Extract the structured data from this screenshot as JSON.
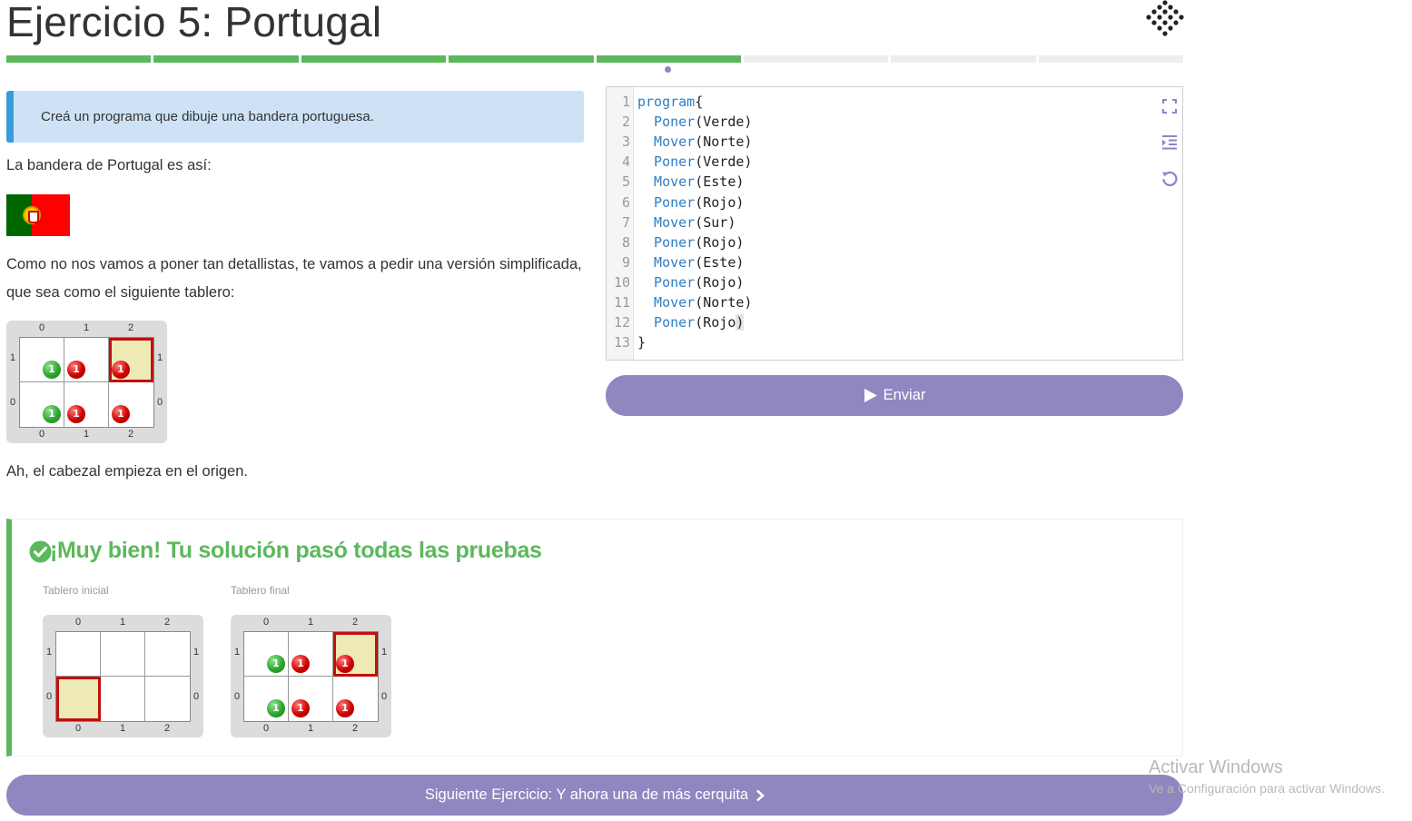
{
  "page": {
    "title": "Ejercicio 5: Portugal"
  },
  "progress": {
    "segments": 8,
    "completed": 5,
    "current": 5
  },
  "statement": {
    "task": "Creá un programa que dibuje una bandera portuguesa.",
    "intro": "La bandera de Portugal es así:",
    "line1": "Como no nos vamos a poner tan detallistas, te vamos a pedir una versión simplificada,",
    "line2": "que sea como el siguiente tablero:",
    "footer": "Ah, el cabezal empieza en el origen."
  },
  "board_labels": {
    "cols": [
      "0",
      "1",
      "2"
    ],
    "rows": [
      "1",
      "0"
    ]
  },
  "boards": {
    "example": {
      "head": {
        "col": 2,
        "row": 1
      },
      "balls": [
        {
          "col": 0,
          "row": 1,
          "color": "green",
          "count": "1"
        },
        {
          "col": 1,
          "row": 1,
          "color": "red",
          "count": "1"
        },
        {
          "col": 2,
          "row": 1,
          "color": "red",
          "count": "1"
        },
        {
          "col": 0,
          "row": 0,
          "color": "green",
          "count": "1"
        },
        {
          "col": 1,
          "row": 0,
          "color": "red",
          "count": "1"
        },
        {
          "col": 2,
          "row": 0,
          "color": "red",
          "count": "1"
        }
      ]
    },
    "initial": {
      "head": {
        "col": 0,
        "row": 0
      },
      "balls": []
    },
    "final": {
      "head": {
        "col": 2,
        "row": 1
      },
      "balls": [
        {
          "col": 0,
          "row": 1,
          "color": "green",
          "count": "1"
        },
        {
          "col": 1,
          "row": 1,
          "color": "red",
          "count": "1"
        },
        {
          "col": 2,
          "row": 1,
          "color": "red",
          "count": "1"
        },
        {
          "col": 0,
          "row": 0,
          "color": "green",
          "count": "1"
        },
        {
          "col": 1,
          "row": 0,
          "color": "red",
          "count": "1"
        },
        {
          "col": 2,
          "row": 0,
          "color": "red",
          "count": "1"
        }
      ]
    }
  },
  "editor": {
    "lines": [
      {
        "num": "1",
        "kw": "program",
        "rest": "{"
      },
      {
        "num": "2",
        "kw": "  Poner",
        "rest": "(Verde)"
      },
      {
        "num": "3",
        "kw": "  Mover",
        "rest": "(Norte)"
      },
      {
        "num": "4",
        "kw": "  Poner",
        "rest": "(Verde)"
      },
      {
        "num": "5",
        "kw": "  Mover",
        "rest": "(Este)"
      },
      {
        "num": "6",
        "kw": "  Poner",
        "rest": "(Rojo)"
      },
      {
        "num": "7",
        "kw": "  Mover",
        "rest": "(Sur)"
      },
      {
        "num": "8",
        "kw": "  Poner",
        "rest": "(Rojo)"
      },
      {
        "num": "9",
        "kw": "  Mover",
        "rest": "(Este)"
      },
      {
        "num": "10",
        "kw": "  Poner",
        "rest": "(Rojo)"
      },
      {
        "num": "11",
        "kw": "  Mover",
        "rest": "(Norte)"
      },
      {
        "num": "12",
        "kw": "  Poner",
        "rest": "(Rojo)"
      },
      {
        "num": "13",
        "kw": "",
        "rest": "}"
      }
    ],
    "tools": [
      "fullscreen-icon",
      "indent-icon",
      "undo-icon"
    ]
  },
  "send_button": {
    "label": "Enviar",
    "icon": "play-icon"
  },
  "result": {
    "title": "¡Muy bien! Tu solución pasó todas las pruebas",
    "initial_caption": "Tablero inicial",
    "final_caption": "Tablero final"
  },
  "next_button": {
    "label": "Siguiente Ejercicio: Y ahora una de más cerquita",
    "icon": "chevron-right-icon"
  },
  "windows_watermark": {
    "title": "Activar Windows",
    "subtitle": "Ve a Configuración para activar Windows."
  },
  "colors": {
    "accent": "#9087c0",
    "success": "#5cb85c",
    "info_bg": "#cde3f5",
    "info_border": "#3a9bd9",
    "keyword": "#2f7ec4"
  }
}
